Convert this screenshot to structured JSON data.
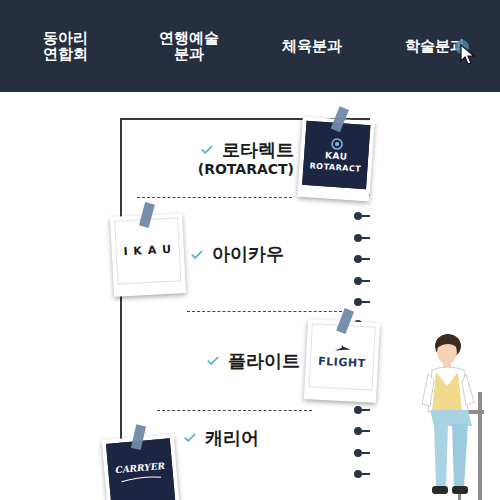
{
  "nav": [
    {
      "label": "동아리\n연합회",
      "hovered": false
    },
    {
      "label": "연행예술\n분과",
      "hovered": false
    },
    {
      "label": "체육분과",
      "hovered": false
    },
    {
      "label": "학술분과",
      "hovered": true
    }
  ],
  "clubs": [
    {
      "name": "로타렉트",
      "subtitle": "(ROTARACT)",
      "logo": {
        "kind": "dark-badge",
        "lines": [
          "KAU",
          "ROTARACT"
        ]
      }
    },
    {
      "name": "아이카우",
      "subtitle": "",
      "logo": {
        "kind": "wordmark",
        "lines": [
          "I K A U"
        ]
      }
    },
    {
      "name": "플라이트",
      "subtitle": "",
      "logo": {
        "kind": "plane-wordmark",
        "lines": [
          "FLIGHT"
        ]
      }
    },
    {
      "name": "캐리어",
      "subtitle": "",
      "logo": {
        "kind": "dark-script",
        "lines": [
          "CARRYER"
        ]
      }
    }
  ]
}
